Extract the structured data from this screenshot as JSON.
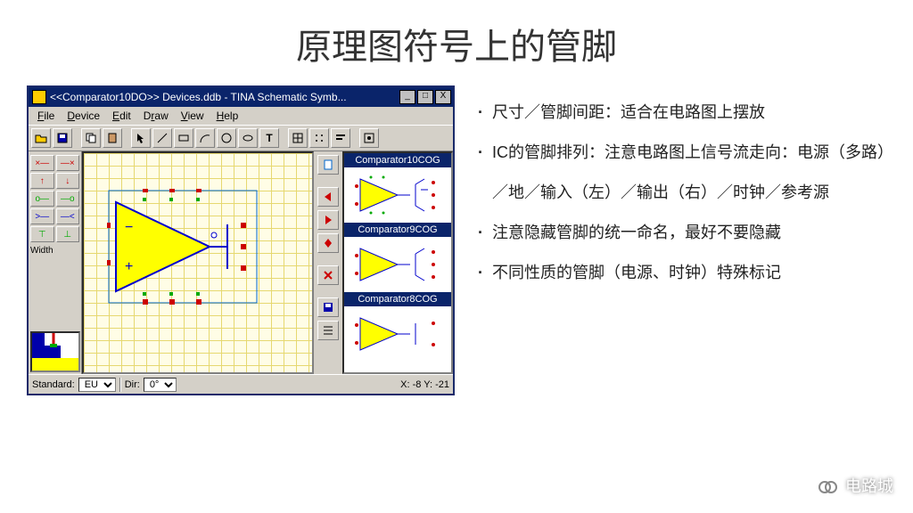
{
  "slide": {
    "title": "原理图符号上的管脚",
    "bullets": [
      "尺寸／管脚间距：适合在电路图上摆放",
      "IC的管脚排列：注意电路图上信号流走向：电源（多路）／地／输入（左）／输出（右）／时钟／参考源",
      "注意隐藏管脚的统一命名，最好不要隐藏",
      "不同性质的管脚（电源、时钟）特殊标记"
    ],
    "watermark": "电路城"
  },
  "app": {
    "title": "<<Comparator10DO>> Devices.ddb - TINA Schematic Symb...",
    "menus": [
      "File",
      "Device",
      "Edit",
      "Draw",
      "View",
      "Help"
    ],
    "toolbar_icons": [
      "folder-icon",
      "save-icon",
      "sep",
      "copy-icon",
      "paste-icon",
      "sep",
      "pointer-icon",
      "line-icon",
      "rect-icon",
      "arc-icon",
      "circle-icon",
      "ellipse-icon",
      "text-icon",
      "sep",
      "grid-icon",
      "snap-icon",
      "align-icon",
      "sep",
      "props-icon"
    ],
    "palette_label": "Width",
    "side_icons": [
      "doc-icon",
      "left-icon",
      "right-icon",
      "up-icon",
      "down-icon",
      "del-icon",
      "save2-icon",
      "list-icon"
    ],
    "components": [
      {
        "name": "Comparator10COG"
      },
      {
        "name": "Comparator9COG"
      },
      {
        "name": "Comparator8COG"
      }
    ],
    "status": {
      "standard_label": "Standard:",
      "standard_value": "EU",
      "dir_label": "Dir:",
      "dir_value": "0°",
      "coords": "X: -8 Y: -21"
    }
  }
}
